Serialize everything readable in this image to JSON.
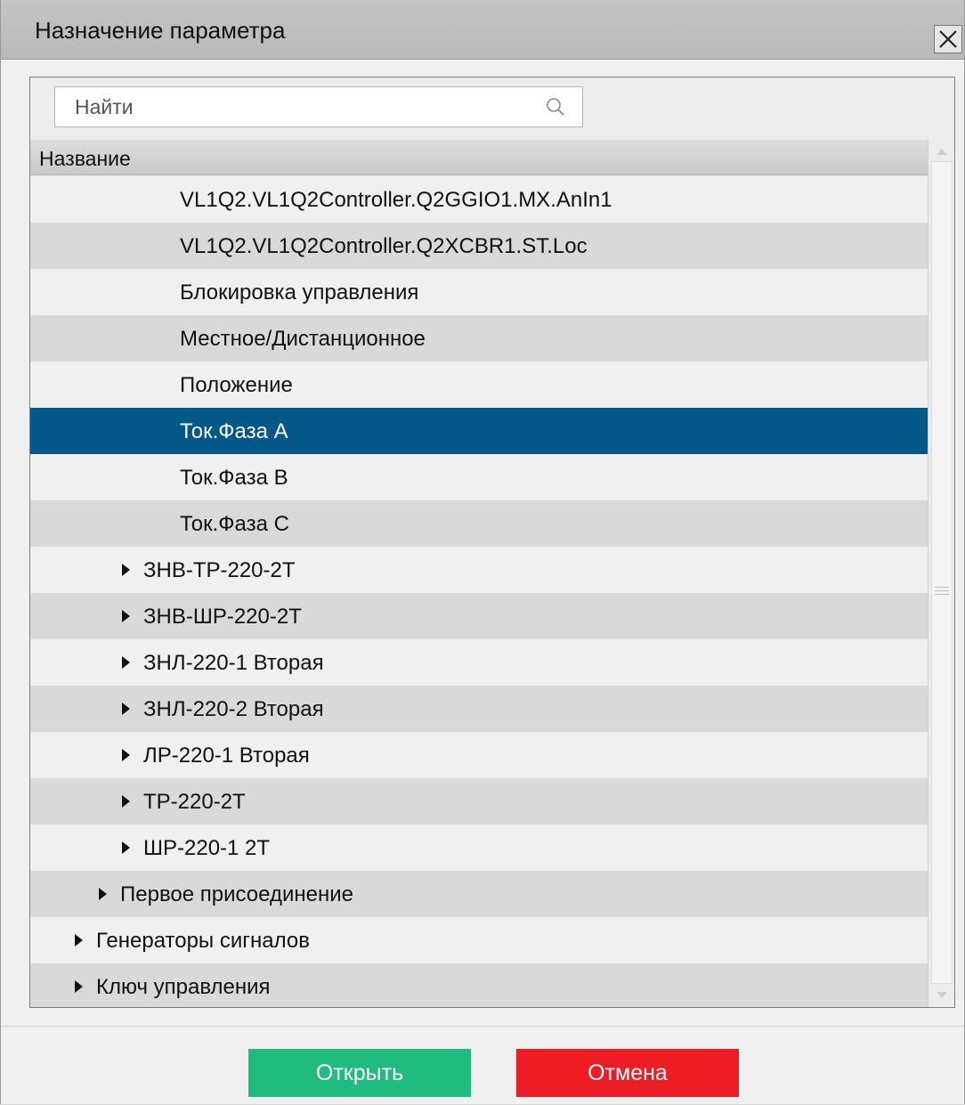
{
  "window": {
    "title": "Назначение параметра",
    "close_icon": "close-icon"
  },
  "search": {
    "placeholder": "Найти",
    "value": "",
    "icon": "search-icon"
  },
  "tree": {
    "column_header": "Название",
    "rows": [
      {
        "label": "VL1Q2.VL1Q2Controller.Q2GGIO1.MX.AnIn1",
        "level": 4,
        "has_children": false,
        "selected": false
      },
      {
        "label": "VL1Q2.VL1Q2Controller.Q2XCBR1.ST.Loc",
        "level": 4,
        "has_children": false,
        "selected": false
      },
      {
        "label": "Блокировка управления",
        "level": 4,
        "has_children": false,
        "selected": false
      },
      {
        "label": "Местное/Дистанционное",
        "level": 4,
        "has_children": false,
        "selected": false
      },
      {
        "label": "Положение",
        "level": 4,
        "has_children": false,
        "selected": false
      },
      {
        "label": "Ток.Фаза А",
        "level": 4,
        "has_children": false,
        "selected": true
      },
      {
        "label": "Ток.Фаза В",
        "level": 4,
        "has_children": false,
        "selected": false
      },
      {
        "label": "Ток.Фаза С",
        "level": 4,
        "has_children": false,
        "selected": false
      },
      {
        "label": "ЗНВ-ТР-220-2Т",
        "level": 3,
        "has_children": true,
        "selected": false
      },
      {
        "label": "ЗНВ-ШР-220-2Т",
        "level": 3,
        "has_children": true,
        "selected": false
      },
      {
        "label": "ЗНЛ-220-1 Вторая",
        "level": 3,
        "has_children": true,
        "selected": false
      },
      {
        "label": "ЗНЛ-220-2 Вторая",
        "level": 3,
        "has_children": true,
        "selected": false
      },
      {
        "label": "ЛР-220-1 Вторая",
        "level": 3,
        "has_children": true,
        "selected": false
      },
      {
        "label": "ТР-220-2Т",
        "level": 3,
        "has_children": true,
        "selected": false
      },
      {
        "label": "ШР-220-1 2Т",
        "level": 3,
        "has_children": true,
        "selected": false
      },
      {
        "label": "Первое присоединение",
        "level": 2,
        "has_children": true,
        "selected": false
      },
      {
        "label": "Генераторы сигналов",
        "level": 1,
        "has_children": true,
        "selected": false
      },
      {
        "label": "Ключ управления",
        "level": 1,
        "has_children": true,
        "selected": false
      }
    ]
  },
  "buttons": {
    "open_label": "Открыть",
    "cancel_label": "Отмена"
  },
  "colors": {
    "selected_row": "#035789",
    "open_button": "#1fbb7f",
    "cancel_button": "#ee1c25"
  }
}
